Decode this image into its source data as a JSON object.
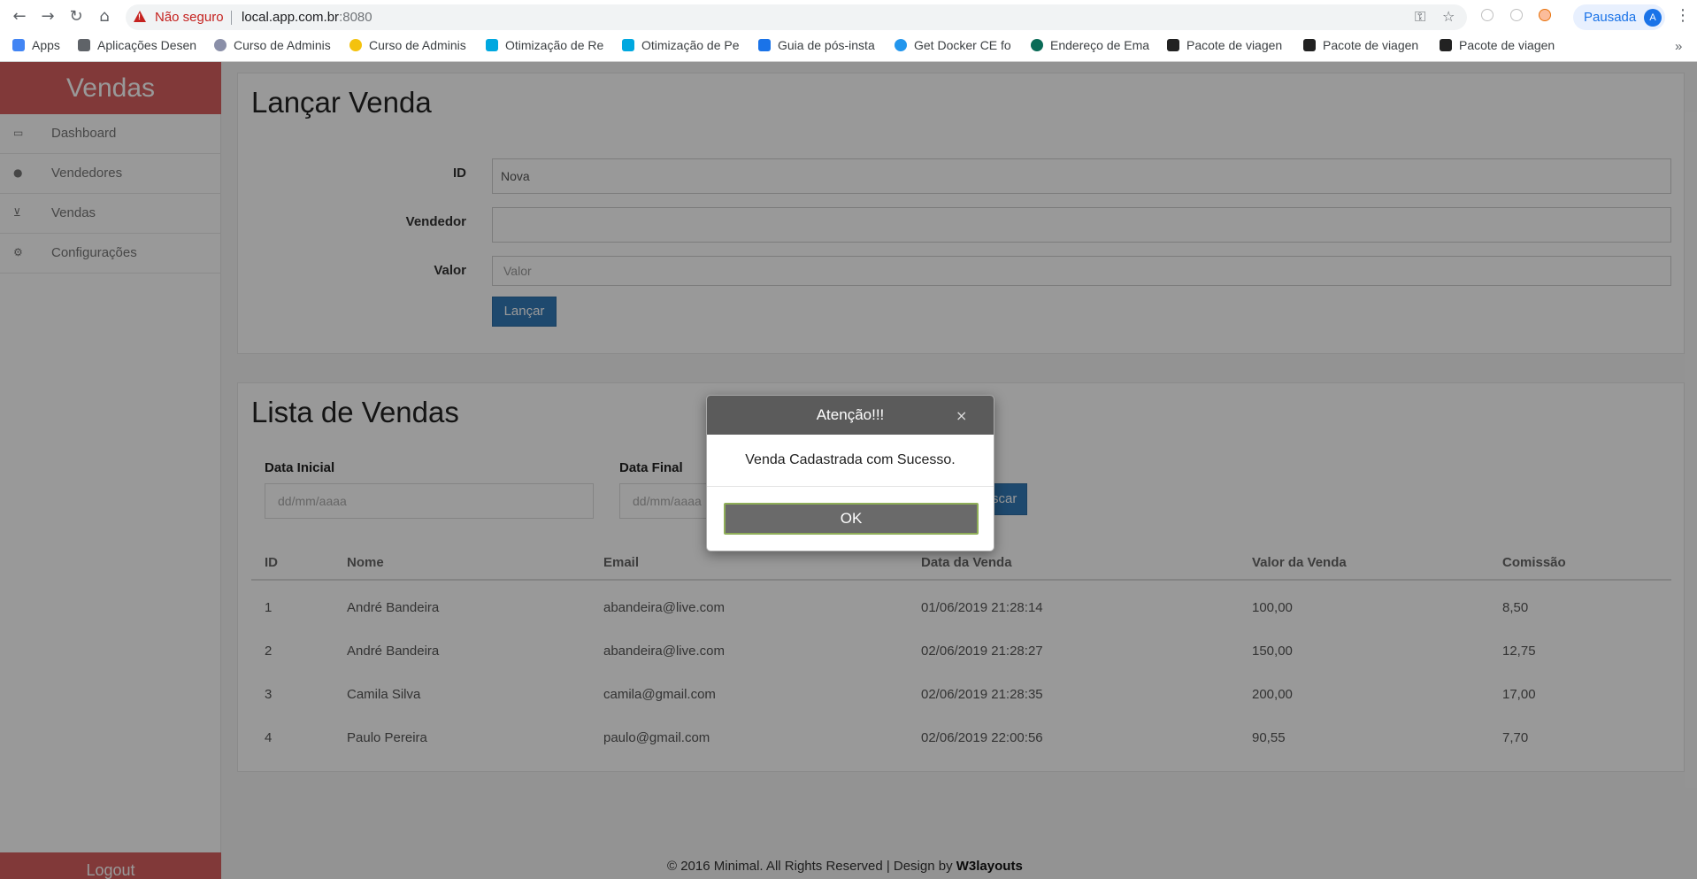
{
  "browser": {
    "security_label": "Não seguro",
    "url_host": "local.app.com.br",
    "url_port": ":8080",
    "profile_label": "Pausada",
    "profile_initial": "A",
    "bookmarks": [
      "Apps",
      "Aplicações Desen",
      "Curso de Adminis",
      "Curso de Adminis",
      "Otimização de Re",
      "Otimização de Pe",
      "Guia de pós-insta",
      "Get Docker CE fo",
      "Endereço de Ema",
      "Pacote de viagen",
      "Pacote de viagen",
      "Pacote de viagen"
    ]
  },
  "sidebar": {
    "brand": "Vendas",
    "items": [
      {
        "label": "Dashboard",
        "icon": "monitor-icon"
      },
      {
        "label": "Vendedores",
        "icon": "user-icon"
      },
      {
        "label": "Vendas",
        "icon": "cart-icon"
      },
      {
        "label": "Configurações",
        "icon": "gears-icon"
      }
    ],
    "logout": "Logout"
  },
  "launch": {
    "title": "Lançar Venda",
    "id_label": "ID",
    "id_value": "Nova",
    "vendedor_label": "Vendedor",
    "vendedor_value": "",
    "valor_label": "Valor",
    "valor_placeholder": "Valor",
    "submit": "Lançar"
  },
  "list": {
    "title": "Lista de Vendas",
    "data_inicial_label": "Data Inicial",
    "data_final_label": "Data Final",
    "date_placeholder": "dd/mm/aaaa",
    "search_button": "Buscar",
    "columns": [
      "ID",
      "Nome",
      "Email",
      "Data da Venda",
      "Valor da Venda",
      "Comissão"
    ],
    "rows": [
      [
        "1",
        "André Bandeira",
        "abandeira@live.com",
        "01/06/2019 21:28:14",
        "100,00",
        "8,50"
      ],
      [
        "2",
        "André Bandeira",
        "abandeira@live.com",
        "02/06/2019 21:28:27",
        "150,00",
        "12,75"
      ],
      [
        "3",
        "Camila Silva",
        "camila@gmail.com",
        "02/06/2019 21:28:35",
        "200,00",
        "17,00"
      ],
      [
        "4",
        "Paulo Pereira",
        "paulo@gmail.com",
        "02/06/2019 22:00:56",
        "90,55",
        "7,70"
      ]
    ]
  },
  "footer": {
    "text": "© 2016 Minimal. All Rights Reserved | Design by ",
    "link": "W3layouts"
  },
  "modal": {
    "title": "Atenção!!!",
    "close": "×",
    "message": "Venda Cadastrada com Sucesso.",
    "ok": "OK"
  },
  "colors": {
    "brand": "#d85f5f",
    "primary_button": "#337ab7",
    "modal_header": "#5b5b5b"
  }
}
